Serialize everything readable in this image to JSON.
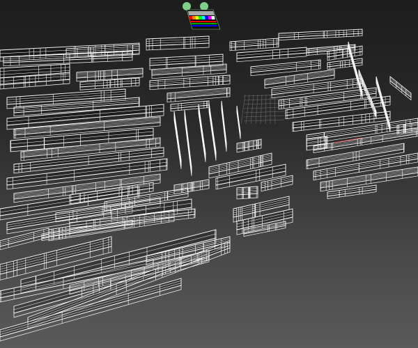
{
  "viewport": {
    "wire_color": "#ffffff",
    "bg_top": "#1c1c1c",
    "bg_bottom": "#5a5a5a",
    "grid_color": "#6a6a6a",
    "accent_red": "#ff5050"
  },
  "palette_card": {
    "handle_color": "#7fcf8a",
    "swatches": [
      "#ff0000",
      "#ff8800",
      "#ffff00",
      "#00ff00",
      "#00ffff",
      "#0000ff",
      "#ff00ff",
      "#ffffff"
    ],
    "stripes": [
      "#ff0000",
      "#00aa00",
      "#0000ff"
    ]
  }
}
